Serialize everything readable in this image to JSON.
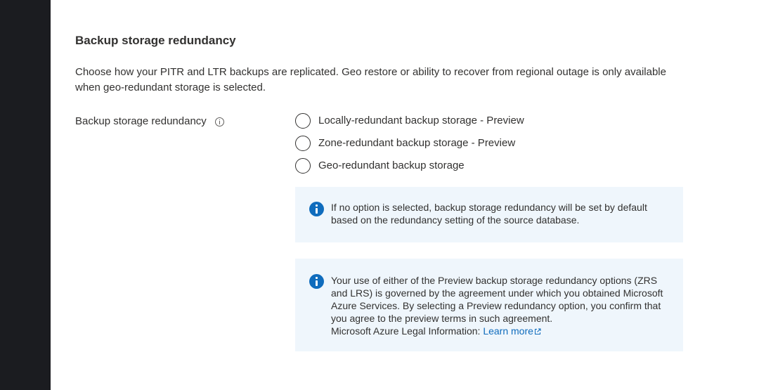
{
  "section": {
    "title": "Backup storage redundancy",
    "description": "Choose how your PITR and LTR backups are replicated. Geo restore or ability to recover from regional outage is only available when geo-redundant storage is selected."
  },
  "field": {
    "label": "Backup storage redundancy",
    "info_icon": "info-outline-icon",
    "options": [
      {
        "label": "Locally-redundant backup storage - Preview",
        "selected": false
      },
      {
        "label": "Zone-redundant backup storage - Preview",
        "selected": false
      },
      {
        "label": "Geo-redundant backup storage",
        "selected": false
      }
    ]
  },
  "info_boxes": [
    {
      "icon": "info-filled-icon",
      "text": "If no option is selected, backup storage redundancy will be set by default based on the redundancy setting of the source database."
    },
    {
      "icon": "info-filled-icon",
      "text": "Your use of either of the Preview backup storage redundancy options (ZRS and LRS) is governed by the agreement under which you obtained Microsoft Azure Services. By selecting a Preview redundancy option, you confirm that you agree to the preview terms in such agreement.",
      "legal_prefix": "Microsoft Azure Legal Information: ",
      "link_label": "Learn more",
      "link_icon": "external-link-icon"
    }
  ],
  "colors": {
    "rail": "#1b1c20",
    "info_background": "#eff6fc",
    "info_icon": "#0f6cbd",
    "link": "#0f6cbd",
    "text": "#323130"
  }
}
